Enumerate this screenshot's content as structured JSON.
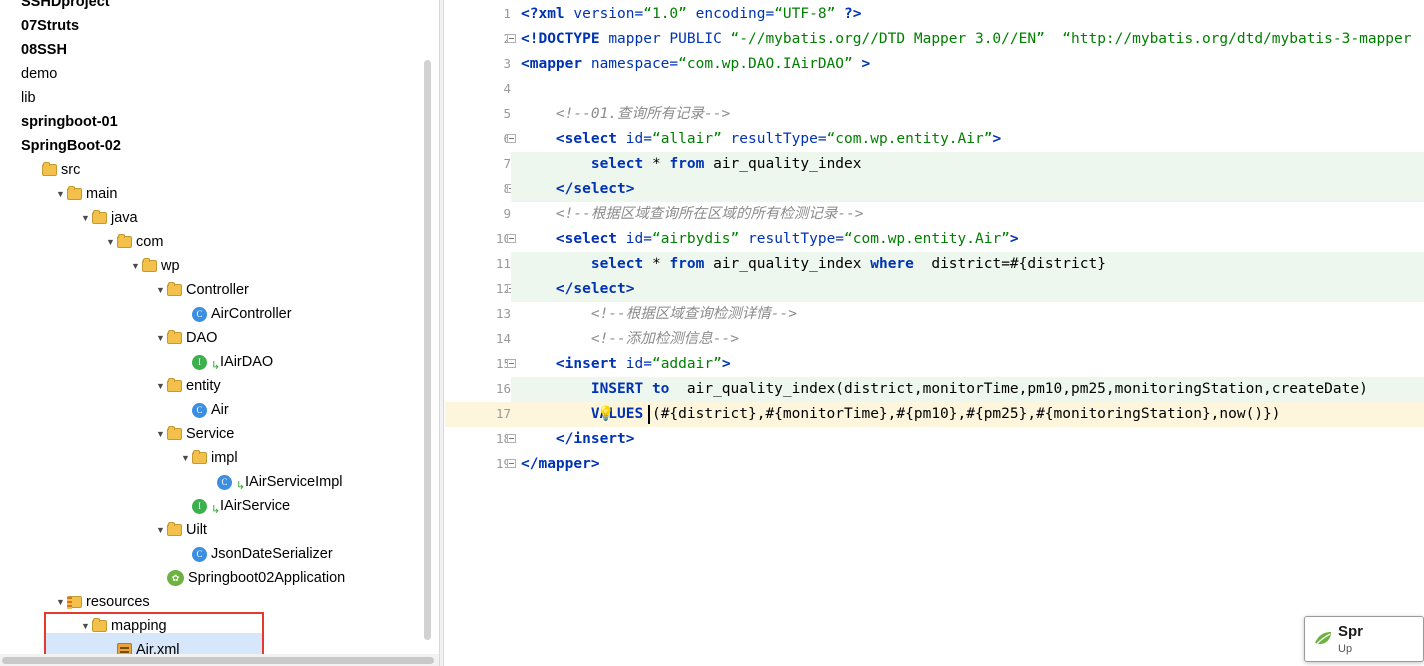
{
  "project_tree": {
    "rows": [
      {
        "indent": 0,
        "label": "SSHDproject",
        "icon": "module-icon",
        "arrow": "none",
        "bold": true,
        "clipped_top": true
      },
      {
        "indent": 0,
        "label": "07Struts",
        "icon": "module-icon",
        "arrow": "none",
        "bold": true
      },
      {
        "indent": 0,
        "label": "08SSH",
        "icon": "module-icon",
        "arrow": "none",
        "bold": true
      },
      {
        "indent": 0,
        "label": "demo",
        "icon": "module-icon",
        "arrow": "none",
        "bold": false
      },
      {
        "indent": 0,
        "label": "lib",
        "icon": "module-icon",
        "arrow": "none",
        "bold": false
      },
      {
        "indent": 0,
        "label": "springboot-01",
        "icon": "module-icon",
        "arrow": "none",
        "bold": true
      },
      {
        "indent": 0,
        "label": "SpringBoot-02",
        "icon": "module-icon",
        "arrow": "none",
        "bold": true
      },
      {
        "indent": 1,
        "label": "src",
        "icon": "src-folder-icon",
        "arrow": "none",
        "bold": false
      },
      {
        "indent": 2,
        "label": "main",
        "icon": "folder-icon",
        "arrow": "down",
        "bold": false
      },
      {
        "indent": 3,
        "label": "java",
        "icon": "src-folder-icon",
        "arrow": "down",
        "bold": false
      },
      {
        "indent": 4,
        "label": "com",
        "icon": "folder-icon",
        "arrow": "down",
        "bold": false
      },
      {
        "indent": 5,
        "label": "wp",
        "icon": "folder-icon",
        "arrow": "down",
        "bold": false
      },
      {
        "indent": 6,
        "label": "Controller",
        "icon": "folder-icon",
        "arrow": "down",
        "bold": false
      },
      {
        "indent": 7,
        "label": "AirController",
        "icon": "class-icon",
        "arrow": "none",
        "bold": false
      },
      {
        "indent": 6,
        "label": "DAO",
        "icon": "folder-icon",
        "arrow": "down",
        "bold": false
      },
      {
        "indent": 7,
        "label": "IAirDAO",
        "icon": "interface-icon",
        "arrow": "none",
        "bold": false,
        "marker": true
      },
      {
        "indent": 6,
        "label": "entity",
        "icon": "folder-icon",
        "arrow": "down",
        "bold": false
      },
      {
        "indent": 7,
        "label": "Air",
        "icon": "class-icon",
        "arrow": "none",
        "bold": false
      },
      {
        "indent": 6,
        "label": "Service",
        "icon": "folder-icon",
        "arrow": "down",
        "bold": false
      },
      {
        "indent": 7,
        "label": "impl",
        "icon": "folder-icon",
        "arrow": "down",
        "bold": false
      },
      {
        "indent": 8,
        "label": "IAirServiceImpl",
        "icon": "class-icon",
        "arrow": "none",
        "bold": false,
        "marker": true
      },
      {
        "indent": 7,
        "label": "IAirService",
        "icon": "interface-icon",
        "arrow": "none",
        "bold": false,
        "marker": true
      },
      {
        "indent": 6,
        "label": "Uilt",
        "icon": "folder-icon",
        "arrow": "down",
        "bold": false
      },
      {
        "indent": 7,
        "label": "JsonDateSerializer",
        "icon": "class-icon",
        "arrow": "none",
        "bold": false
      },
      {
        "indent": 6,
        "label": "Springboot02Application",
        "icon": "spring-icon",
        "arrow": "none",
        "bold": false
      },
      {
        "indent": 2,
        "label": "resources",
        "icon": "resources-folder-icon",
        "arrow": "down",
        "bold": false
      },
      {
        "indent": 3,
        "label": "mapping",
        "icon": "folder-icon",
        "arrow": "down",
        "bold": false
      },
      {
        "indent": 4,
        "label": "Air.xml",
        "icon": "xml-file-icon",
        "arrow": "none",
        "bold": false,
        "selected": true
      }
    ]
  },
  "editor": {
    "line_numbers": [
      "1",
      "2",
      "3",
      "4",
      "5",
      "6",
      "7",
      "8",
      "9",
      "10",
      "11",
      "12",
      "13",
      "14",
      "15",
      "16",
      "17",
      "18",
      "19"
    ],
    "lines": [
      {
        "n": 1,
        "html": "<span class=\"tag\">&lt;?xml </span><span class=\"attr\">version=</span><span class=\"str\">“1.0”</span><span class=\"attr\"> encoding=</span><span class=\"str\">“UTF-8”</span><span class=\"tag\"> ?&gt;</span>"
      },
      {
        "n": 2,
        "html": "<span class=\"tag\">&lt;!DOCTYPE </span><span class=\"attr\">mapper PUBLIC </span><span class=\"str\">“-//mybatis.org//DTD Mapper 3.0//EN”</span><span class=\"str\">  “http://mybatis.org/dtd/mybatis-3-mapper</span>"
      },
      {
        "n": 3,
        "html": "<span class=\"tag\">&lt;mapper </span><span class=\"attr\">namespace=</span><span class=\"str\">“com.wp.DAO.IAirDAO”</span><span class=\"tag\"> &gt;</span>"
      },
      {
        "n": 4,
        "html": ""
      },
      {
        "n": 5,
        "html": "    <span class=\"cmt\">&lt;!--01.查询所有记录--&gt;</span>"
      },
      {
        "n": 6,
        "html": "    <span class=\"tag\">&lt;select </span><span class=\"attr\">id=</span><span class=\"str\">“allair”</span><span class=\"attr\"> resultType=</span><span class=\"str\">“com.wp.entity.Air”</span><span class=\"tag\">&gt;</span>"
      },
      {
        "n": 7,
        "html": "        <span class=\"kw\">select</span><span class=\"plain\"> * </span><span class=\"kw\">from</span><span class=\"plain\"> air_quality_index</span>"
      },
      {
        "n": 8,
        "html": "    <span class=\"tag\">&lt;/select&gt;</span>"
      },
      {
        "n": 9,
        "html": "    <span class=\"cmt\">&lt;!--根据区域查询所在区域的所有检测记录--&gt;</span>"
      },
      {
        "n": 10,
        "html": "    <span class=\"tag\">&lt;select </span><span class=\"attr\">id=</span><span class=\"str\">“airbydis”</span><span class=\"attr\"> resultType=</span><span class=\"str\">“com.wp.entity.Air”</span><span class=\"tag\">&gt;</span>"
      },
      {
        "n": 11,
        "html": "        <span class=\"kw\">select</span><span class=\"plain\"> * </span><span class=\"kw\">from</span><span class=\"plain\"> air_quality_index </span><span class=\"kw\">where</span><span class=\"plain\">  district=#{district}</span>"
      },
      {
        "n": 12,
        "html": "    <span class=\"tag\">&lt;/select&gt;</span>"
      },
      {
        "n": 13,
        "html": "        <span class=\"cmt\">&lt;!--根据区域查询检测详情--&gt;</span>"
      },
      {
        "n": 14,
        "html": "        <span class=\"cmt\">&lt;!--添加检测信息--&gt;</span>"
      },
      {
        "n": 15,
        "html": "    <span class=\"tag\">&lt;insert </span><span class=\"attr\">id=</span><span class=\"str\">“addair”</span><span class=\"tag\">&gt;</span>"
      },
      {
        "n": 16,
        "html": "        <span class=\"kw\">INSERT to</span><span class=\"plain\">  air_quality_index(district,monitorTime,pm10,pm25,monitoringStation,createDate)</span>"
      },
      {
        "n": 17,
        "html": "        <span class=\"kw\">VALUES</span><span class=\"plain\"> (#{district},#{monitorTime},#{pm10},#{pm25},#{monitoringStation},now()})</span>"
      },
      {
        "n": 18,
        "html": "    <span class=\"tag\">&lt;/insert&gt;</span>"
      },
      {
        "n": 19,
        "html": "<span class=\"tag\">&lt;/mapper&gt;</span>"
      }
    ],
    "highlight_green_lines": [
      7,
      8,
      11,
      12,
      16
    ],
    "highlight_yellow_lines": [
      17
    ],
    "fold_lines": [
      2,
      6,
      8,
      10,
      12,
      15,
      18,
      19
    ],
    "bulb_line": 17,
    "caret_line": 17
  },
  "spring_chip": {
    "title": "Spr",
    "subtitle": "Up"
  },
  "colors": {
    "selection_box": "#e23b2e",
    "row_selection": "#d6e6fb",
    "green_highlight": "#eef7ee",
    "yellow_highlight": "#fdf6dd",
    "string": "#008000",
    "tag": "#0033b3",
    "comment": "#8c8c8c"
  }
}
